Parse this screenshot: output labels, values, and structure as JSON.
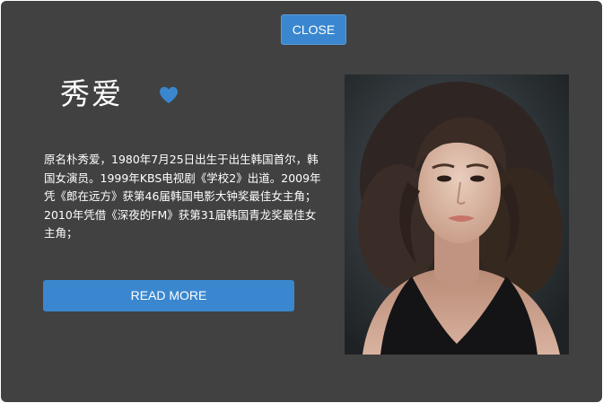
{
  "modal": {
    "close_label": "CLOSE",
    "name": "秀爱",
    "bio": "原名朴秀爱，1980年7月25日出生于出生韩国首尔，韩国女演员。1999年KBS电视剧《学校2》出道。2009年凭《郎在远方》获第46届韩国电影大钟奖最佳女主角；2010年凭借《深夜的FM》获第31届韩国青龙奖最佳女主角；",
    "read_more_label": "READ MORE"
  },
  "icons": {
    "favorite": "heart-icon"
  },
  "colors": {
    "panel_background": "#414141",
    "accent": "#3a87cf",
    "text": "#ffffff"
  }
}
